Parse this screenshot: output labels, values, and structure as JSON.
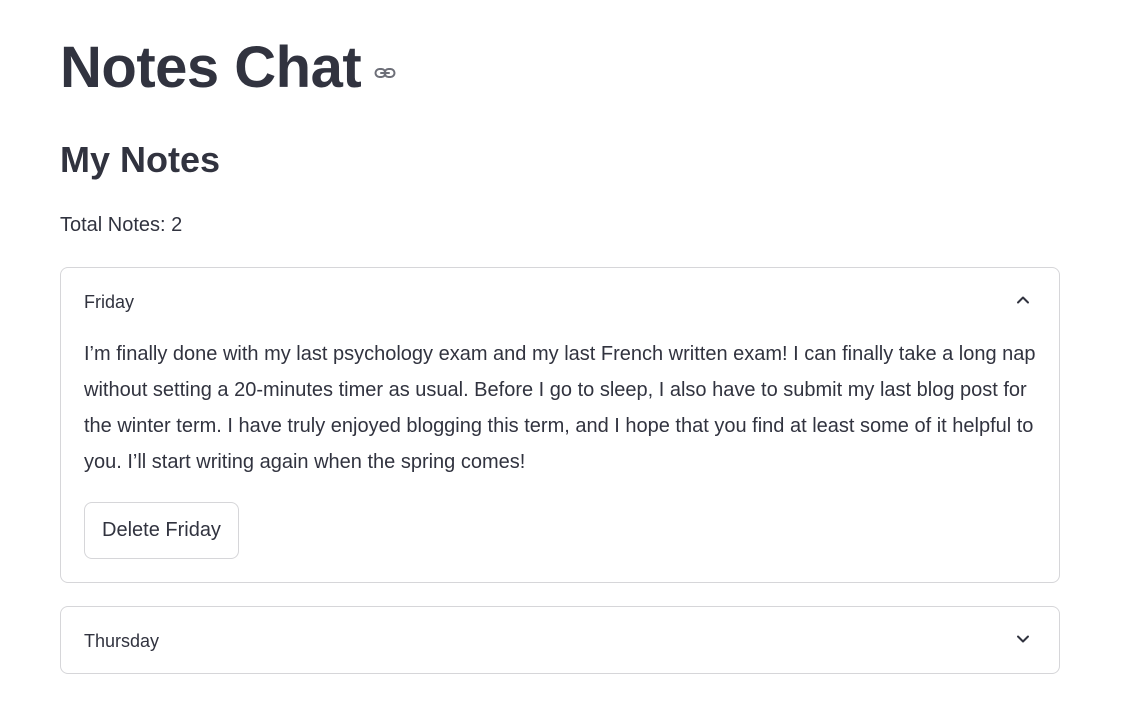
{
  "page": {
    "title": "Notes Chat",
    "anchor_icon": "link-icon"
  },
  "notes_section": {
    "heading": "My Notes",
    "total_label": "Total Notes: 2"
  },
  "notes": [
    {
      "label": "Friday",
      "expanded": true,
      "chevron_icon": "chevron-up-icon",
      "body": "I’m finally done with my last psychology exam and my last French written exam! I can finally take a long nap without setting a 20-minutes timer as usual. Before I go to sleep, I also have to submit my last blog post for the winter term. I have truly enjoyed blogging this term, and I hope that you find at least some of it helpful to you. I’ll start writing again when the spring comes!",
      "delete_label": "Delete Friday"
    },
    {
      "label": "Thursday",
      "expanded": false,
      "chevron_icon": "chevron-down-icon"
    }
  ],
  "colors": {
    "text": "#31333f",
    "border": "#d6d6d9",
    "background": "#ffffff",
    "icon": "#6d6f78"
  }
}
